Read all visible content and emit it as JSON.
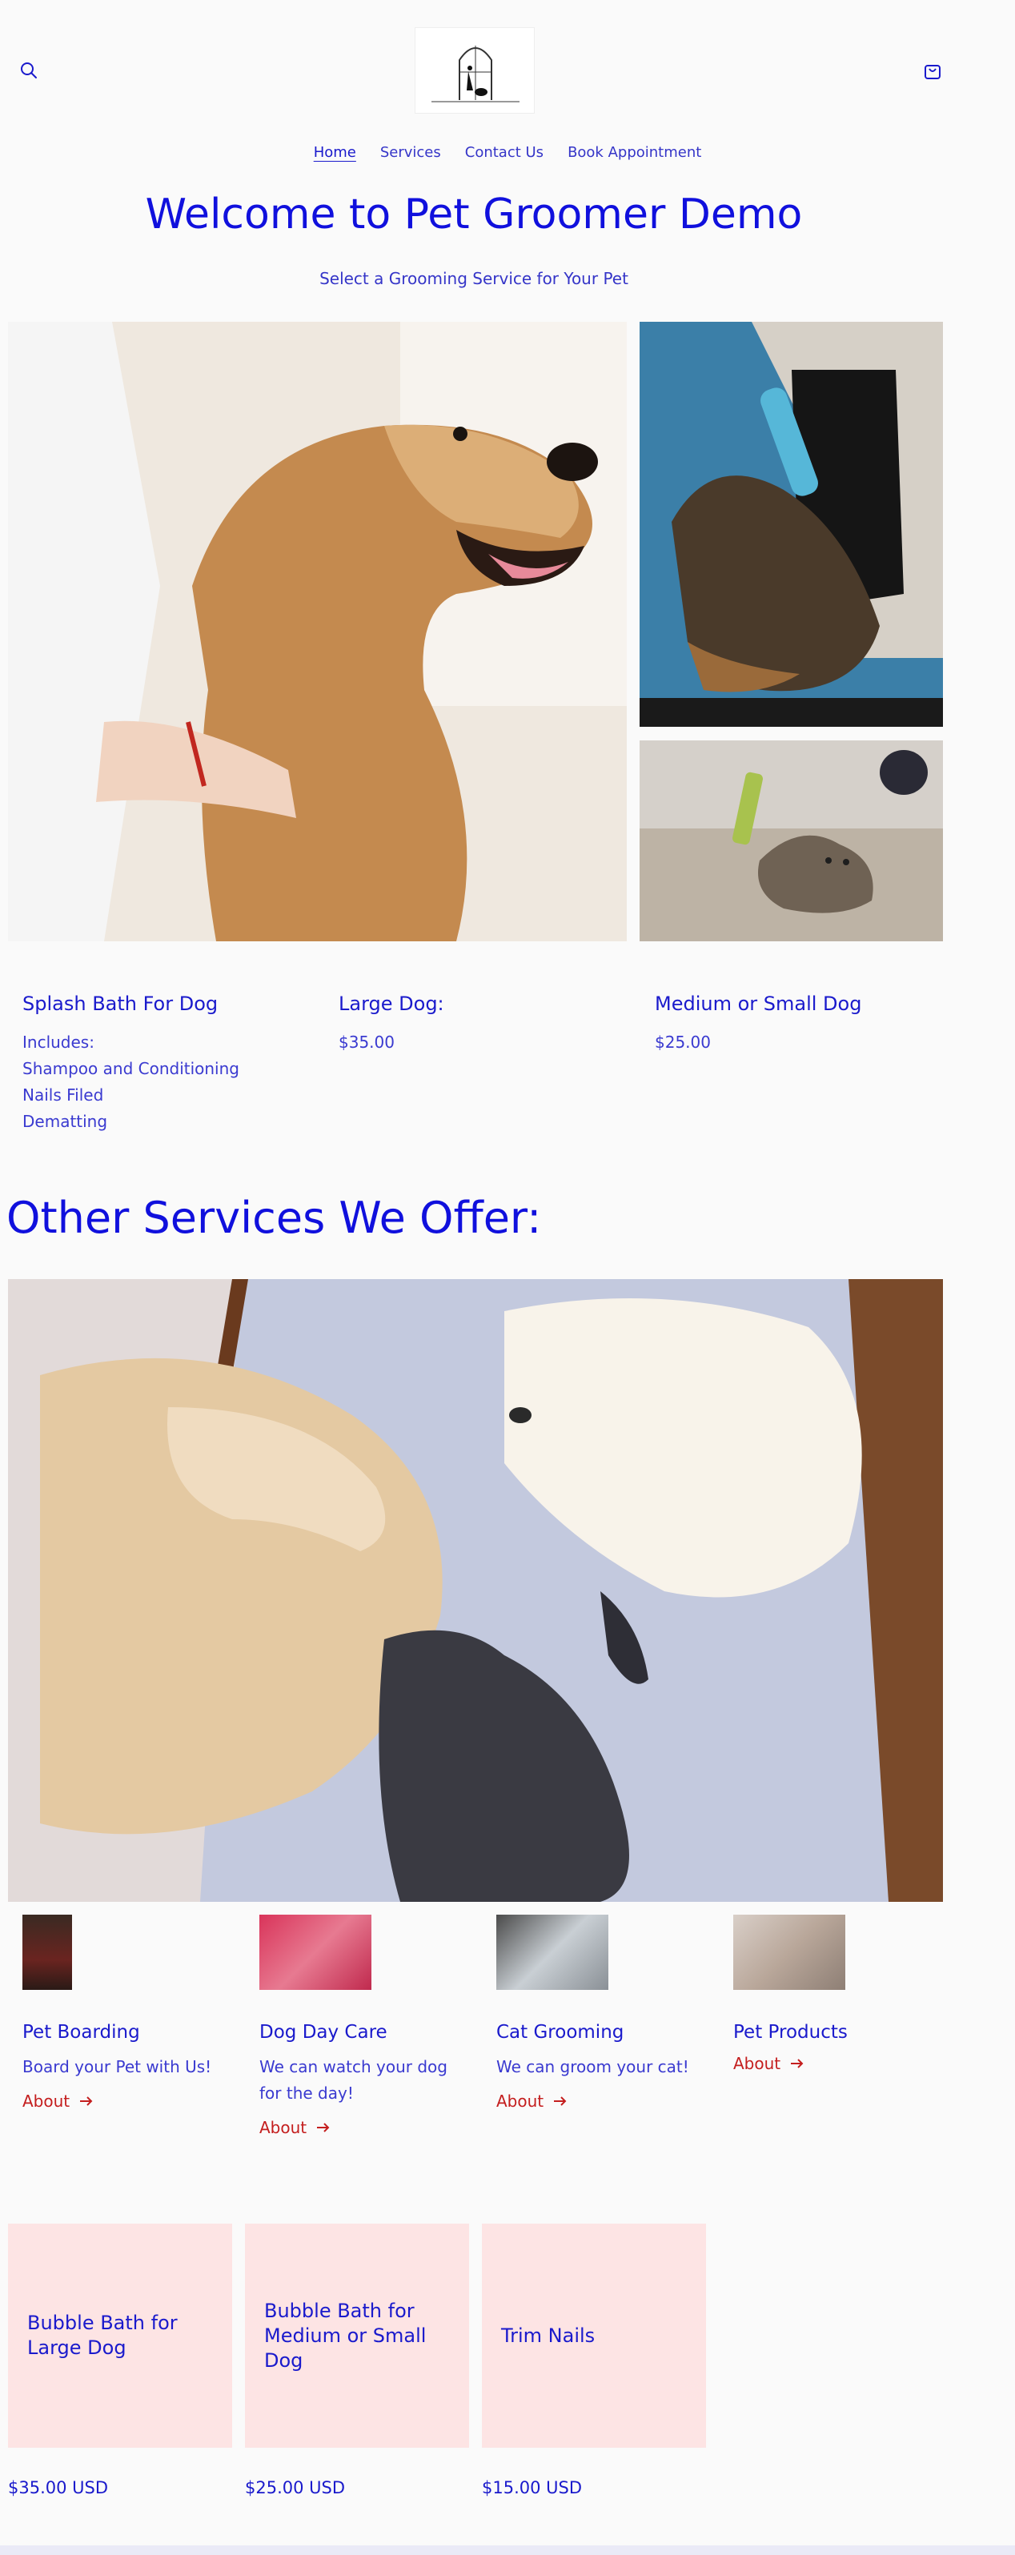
{
  "nav": {
    "items": [
      {
        "label": "Home"
      },
      {
        "label": "Services"
      },
      {
        "label": "Contact Us"
      },
      {
        "label": "Book Appointment"
      }
    ]
  },
  "hero": {
    "title": "Welcome to Pet Groomer Demo",
    "subtitle": "Select a Grooming Service for Your Pet"
  },
  "pricing": {
    "columns": [
      {
        "title": "Splash Bath For Dog",
        "lines": [
          "Includes:",
          "Shampoo and Conditioning",
          "Nails Filed",
          "Dematting"
        ]
      },
      {
        "title": "Large Dog:",
        "lines": [
          "$35.00"
        ]
      },
      {
        "title": "Medium or Small Dog",
        "lines": [
          "$25.00"
        ]
      }
    ]
  },
  "offer": {
    "title": "Other Services We Offer:"
  },
  "services": [
    {
      "title": "Pet Boarding",
      "text": "Board your Pet with Us!",
      "link": "About"
    },
    {
      "title": "Dog Day Care",
      "text": "We can watch your dog for the day!",
      "link": "About"
    },
    {
      "title": "Cat Grooming",
      "text": "We can groom your cat!",
      "link": "About"
    },
    {
      "title": "Pet Products",
      "text": "",
      "link": "About"
    }
  ],
  "products": [
    {
      "name": "Bubble Bath for Large Dog",
      "price": "$35.00 USD"
    },
    {
      "name": "Bubble Bath for Medium or Small Dog",
      "price": "$25.00 USD"
    },
    {
      "name": "Trim Nails",
      "price": "$15.00 USD"
    }
  ],
  "colors": {
    "accent": "#1010dd",
    "link_red": "#c41e1e",
    "card_pink": "#fde4e4",
    "background": "#fafafa"
  }
}
